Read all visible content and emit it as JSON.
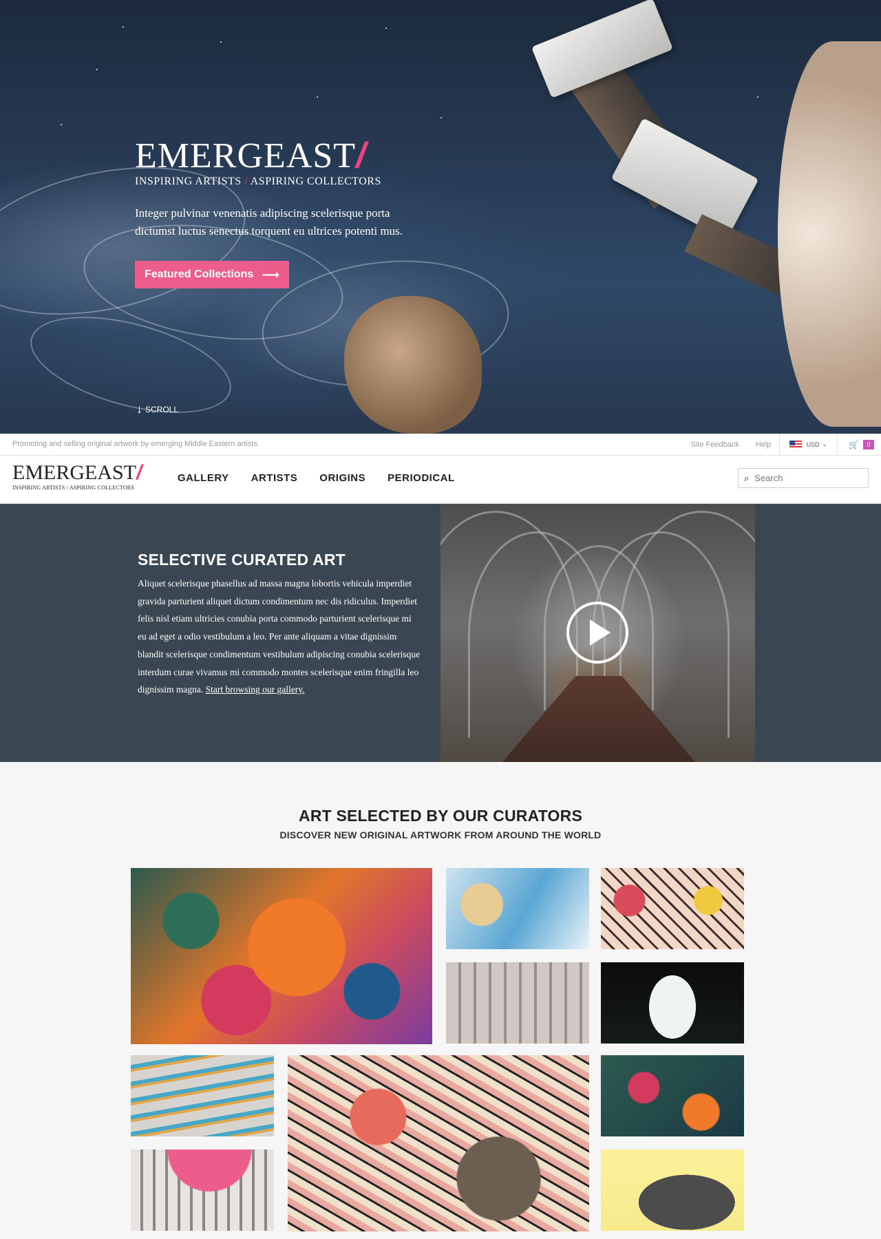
{
  "hero": {
    "logo_word": "EMERGEAST",
    "logo_slash": "/",
    "tagline_left": "INSPIRING ARTISTS",
    "tagline_sep": "/",
    "tagline_right": "ASPIRING COLLECTORS",
    "intro": "Integer pulvinar venenatis adipiscing scelerisque porta dictumst luctus senectus torquent eu ultrices potenti mus.",
    "cta_label": "Featured Collections",
    "cta_arrow": "⟶",
    "scroll_label": "SCROLL",
    "scroll_icon": "↓"
  },
  "infobar": {
    "promo": "Promoting and selling original artwork by emerging Middle Eastern artists.",
    "feedback": "Site Feedback",
    "help": "Help",
    "currency": "USD",
    "currency_caret": "⌄",
    "cart_count": "0",
    "cart_icon": "🛒"
  },
  "nav": {
    "logo_word": "EMERGEAST",
    "logo_slash": "/",
    "logo_tag": "INSPIRING ARTISTS / ASPIRING COLLECTORS",
    "items": [
      {
        "label": "GALLERY"
      },
      {
        "label": "ARTISTS"
      },
      {
        "label": "ORIGINS"
      },
      {
        "label": "PERIODICAL"
      }
    ],
    "search_placeholder": "Search",
    "search_icon": "⌕"
  },
  "curated": {
    "title": "SELECTIVE CURATED ART",
    "body": "Aliquet scelerisque phasellus ad massa magna lobortis vehicula imperdiet gravida parturient aliquet dictum condimentum nec dis ridiculus. Imperdiet felis nisl etiam ultricies conubia porta commodo parturient scelerisque mi eu ad eget a odio vestibulum a leo. Per ante aliquam a vitae dignissim blandit scelerisque condimentum vestibulum adipiscing conubia scelerisque interdum curae vivamus mi commodo montes scelerisque enim fringilla leo dignissim magna. ",
    "link": "Start browsing our gallery."
  },
  "gallery": {
    "title": "ART SELECTED BY OUR CURATORS",
    "subtitle": "DISCOVER NEW ORIGINAL ARTWORK FROM AROUND THE WORLD"
  },
  "colors": {
    "accent": "#e9467b",
    "button": "#ec5d8b",
    "curated_bg": "#3a4651",
    "cart_badge": "#c756b4"
  }
}
